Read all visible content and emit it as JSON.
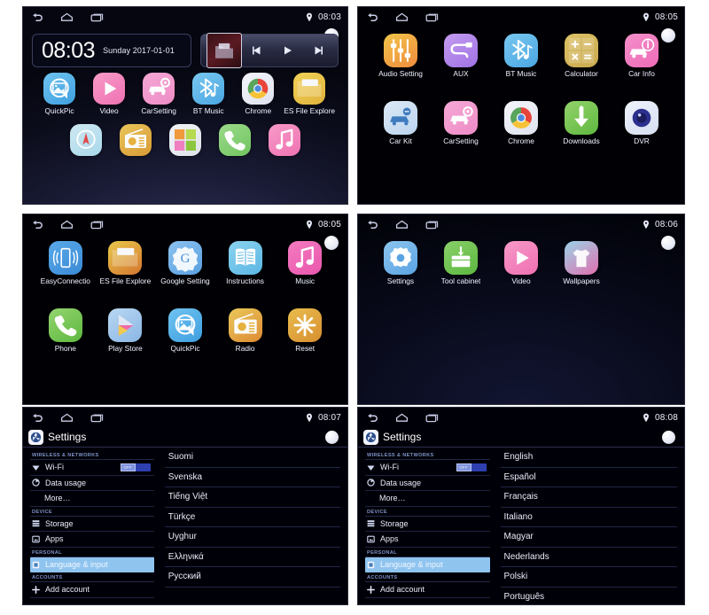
{
  "panels": [
    {
      "id": "home-screen",
      "status": {
        "time": "08:03",
        "location_icon": "location-pin-icon"
      },
      "clock_widget": {
        "time": "08:03",
        "date": "Sunday 2017-01-01"
      },
      "media_widget": {
        "prev_icon": "previous-track-icon",
        "play_icon": "play-icon",
        "next_icon": "next-track-icon",
        "album_art_icon": "album-art-icon"
      },
      "apps": [
        {
          "label": "QuickPic",
          "icon": "quickpic-icon",
          "c1": "#6fc3f0",
          "c2": "#3f9fe0"
        },
        {
          "label": "Video",
          "icon": "video-icon",
          "c1": "#f79ac8",
          "c2": "#ef72b2"
        },
        {
          "label": "CarSetting",
          "icon": "carsetting-icon",
          "c1": "#f5a8d6",
          "c2": "#ee8cc6"
        },
        {
          "label": "BT Music",
          "icon": "bluetooth-music-icon",
          "c1": "#79c8ef",
          "c2": "#4aa6e2"
        },
        {
          "label": "Chrome",
          "icon": "chrome-icon",
          "c1": "#f4f6fb",
          "c2": "#dfe3ee"
        },
        {
          "label": "ES File Explore",
          "icon": "folder-icon",
          "c1": "#f2d257",
          "c2": "#e0b23c"
        }
      ],
      "dock": [
        {
          "label": "Navigation",
          "icon": "compass-icon",
          "c1": "#cfe9f2",
          "c2": "#a8d8ea"
        },
        {
          "label": "Radio",
          "icon": "radio-icon",
          "c1": "#e9c55b",
          "c2": "#d99a35"
        },
        {
          "label": "Apps",
          "icon": "app-grid-icon",
          "c1": "#f0f2f6",
          "c2": "#dfe3ea"
        },
        {
          "label": "Phone",
          "icon": "phone-icon",
          "c1": "#9bd98b",
          "c2": "#71c55f"
        },
        {
          "label": "Music",
          "icon": "music-note-icon",
          "c1": "#f79ac8",
          "c2": "#ef72b2"
        }
      ]
    },
    {
      "id": "app-drawer-page-1",
      "status": {
        "time": "08:05",
        "location_icon": "location-pin-icon"
      },
      "apps": [
        {
          "label": "Audio Setting",
          "icon": "equalizer-icon",
          "c1": "#f3c54a",
          "c2": "#ef8b3c"
        },
        {
          "label": "AUX",
          "icon": "aux-cable-icon",
          "c1": "#c39bf0",
          "c2": "#a072e4"
        },
        {
          "label": "BT Music",
          "icon": "bluetooth-music-icon",
          "c1": "#79c8ef",
          "c2": "#4aa6e2"
        },
        {
          "label": "Calculator",
          "icon": "calculator-icon",
          "c1": "#ddc166",
          "c2": "#c9a94f"
        },
        {
          "label": "Car Info",
          "icon": "car-info-icon",
          "c1": "#f58fcb",
          "c2": "#ee6bb6"
        },
        {
          "label": "Car Kit",
          "icon": "car-kit-icon",
          "c1": "#dce9f7",
          "c2": "#bcd4ee"
        },
        {
          "label": "CarSetting",
          "icon": "carsetting-icon",
          "c1": "#f5a8d6",
          "c2": "#ee8cc6"
        },
        {
          "label": "Chrome",
          "icon": "chrome-icon",
          "c1": "#f4f6fb",
          "c2": "#dfe3ee"
        },
        {
          "label": "Downloads",
          "icon": "download-icon",
          "c1": "#93d26b",
          "c2": "#5fb83f"
        },
        {
          "label": "DVR",
          "icon": "dvr-camera-icon",
          "c1": "#eef2fb",
          "c2": "#d6def0"
        }
      ]
    },
    {
      "id": "app-drawer-page-2",
      "status": {
        "time": "08:05",
        "location_icon": "location-pin-icon"
      },
      "apps": [
        {
          "label": "EasyConnectio",
          "icon": "easyconnection-icon",
          "c1": "#5aa9e8",
          "c2": "#3a8ad6"
        },
        {
          "label": "ES File Explore",
          "icon": "folder-icon",
          "c1": "#e8c94c",
          "c2": "#d4762f"
        },
        {
          "label": "Google Setting",
          "icon": "google-settings-icon",
          "c1": "#8cc2ef",
          "c2": "#5a9fe0"
        },
        {
          "label": "Instructions",
          "icon": "book-icon",
          "c1": "#8ad3ef",
          "c2": "#5bb6e4"
        },
        {
          "label": "Music",
          "icon": "music-note-icon",
          "c1": "#f47bc0",
          "c2": "#e957ad"
        },
        {
          "label": "Phone",
          "icon": "phone-icon",
          "c1": "#93d46f",
          "c2": "#5eb83f"
        },
        {
          "label": "Play Store",
          "icon": "play-store-icon",
          "c1": "#b9d7f2",
          "c2": "#8ab6e4"
        },
        {
          "label": "QuickPic",
          "icon": "quickpic-icon",
          "c1": "#6fc3f0",
          "c2": "#3f9fe0"
        },
        {
          "label": "Radio",
          "icon": "radio-icon",
          "c1": "#eac85a",
          "c2": "#dd8b33"
        },
        {
          "label": "Reset",
          "icon": "reset-icon",
          "c1": "#e9bc4e",
          "c2": "#d88f30"
        }
      ]
    },
    {
      "id": "app-drawer-page-3",
      "status": {
        "time": "08:06",
        "location_icon": "location-pin-icon"
      },
      "apps": [
        {
          "label": "Settings",
          "icon": "gear-icon",
          "c1": "#8cc5ef",
          "c2": "#5aa3e2"
        },
        {
          "label": "Tool cabinet",
          "icon": "tool-cabinet-icon",
          "c1": "#8ad06a",
          "c2": "#5cb83f"
        },
        {
          "label": "Video",
          "icon": "video-icon",
          "c1": "#f79ac8",
          "c2": "#ef6fb2"
        },
        {
          "label": "Wallpapers",
          "icon": "wallpapers-icon",
          "c1": "#9ad4e8",
          "c2": "#e06fae"
        }
      ]
    },
    {
      "id": "settings-language-list-a",
      "status": {
        "time": "08:07",
        "location_icon": "location-pin-icon"
      },
      "header": {
        "title": "Settings",
        "icon": "settings-app-icon"
      },
      "sidebar": [
        {
          "type": "group",
          "label": "WIRELESS & NETWORKS"
        },
        {
          "type": "item",
          "label": "Wi-Fi",
          "icon": "wifi-icon",
          "toggle": "OFF"
        },
        {
          "type": "item",
          "label": "Data usage",
          "icon": "data-usage-icon"
        },
        {
          "type": "item",
          "label": "More…",
          "icon": "none",
          "indent": true
        },
        {
          "type": "group",
          "label": "DEVICE"
        },
        {
          "type": "item",
          "label": "Storage",
          "icon": "storage-icon"
        },
        {
          "type": "item",
          "label": "Apps",
          "icon": "apps-icon"
        },
        {
          "type": "group",
          "label": "PERSONAL"
        },
        {
          "type": "item",
          "label": "Language & input",
          "icon": "language-icon",
          "selected": true
        },
        {
          "type": "group",
          "label": "ACCOUNTS"
        },
        {
          "type": "item",
          "label": "Add account",
          "icon": "plus-icon"
        }
      ],
      "languages": [
        "Suomi",
        "Svenska",
        "Tiếng Việt",
        "Türkçe",
        "Uyghur",
        "Ελληνικά",
        "Русский"
      ]
    },
    {
      "id": "settings-language-list-b",
      "status": {
        "time": "08:08",
        "location_icon": "location-pin-icon"
      },
      "header": {
        "title": "Settings",
        "icon": "settings-app-icon"
      },
      "sidebar": [
        {
          "type": "group",
          "label": "WIRELESS & NETWORKS"
        },
        {
          "type": "item",
          "label": "Wi-Fi",
          "icon": "wifi-icon",
          "toggle": "OFF"
        },
        {
          "type": "item",
          "label": "Data usage",
          "icon": "data-usage-icon"
        },
        {
          "type": "item",
          "label": "More…",
          "icon": "none",
          "indent": true
        },
        {
          "type": "group",
          "label": "DEVICE"
        },
        {
          "type": "item",
          "label": "Storage",
          "icon": "storage-icon"
        },
        {
          "type": "item",
          "label": "Apps",
          "icon": "apps-icon"
        },
        {
          "type": "group",
          "label": "PERSONAL"
        },
        {
          "type": "item",
          "label": "Language & input",
          "icon": "language-icon",
          "selected": true
        },
        {
          "type": "group",
          "label": "ACCOUNTS"
        },
        {
          "type": "item",
          "label": "Add account",
          "icon": "plus-icon"
        }
      ],
      "languages": [
        "English",
        "Español",
        "Français",
        "Italiano",
        "Magyar",
        "Nederlands",
        "Polski",
        "Português"
      ]
    }
  ]
}
